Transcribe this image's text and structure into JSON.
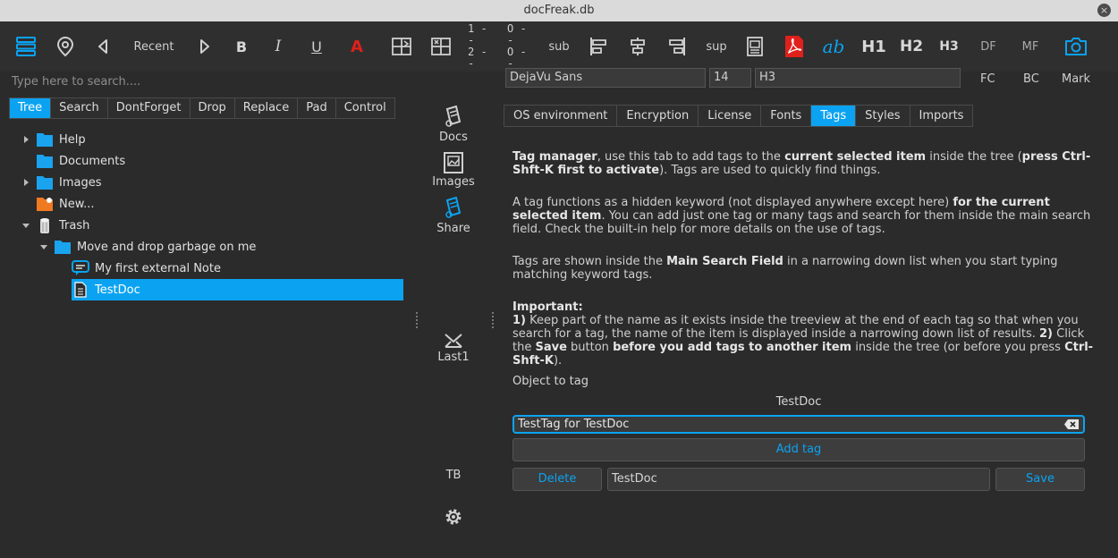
{
  "window": {
    "title": "docFreak.db",
    "close_glyph": "×"
  },
  "toolbar": {
    "recent": "Recent",
    "bold": "B",
    "italic": "I",
    "underline": "U",
    "color": "A",
    "list_num_1": "1 --",
    "list_num_2": "2 --",
    "list_bul_1": "O --",
    "list_bul_2": "O --",
    "sub": "sub",
    "sup": "sup",
    "spell": "ab",
    "h1": "H1",
    "h2": "H2",
    "h3": "H3",
    "df": "DF",
    "mf": "MF",
    "fc": "FC",
    "bc": "BC",
    "mark": "Mark"
  },
  "search": {
    "placeholder": "Type here to search...."
  },
  "format": {
    "font": "DejaVu Sans",
    "size": "14",
    "style": "H3"
  },
  "left_tabs": [
    "Tree",
    "Search",
    "DontForget",
    "Drop",
    "Replace",
    "Pad",
    "Control"
  ],
  "tree": {
    "help": "Help",
    "documents": "Documents",
    "images": "Images",
    "new": "New...",
    "trash": "Trash",
    "move": "Move  and drop garbage on me",
    "note": "My first external Note",
    "testdoc": "TestDoc"
  },
  "side": {
    "docs": "Docs",
    "images": "Images",
    "share": "Share",
    "last1": "Last1",
    "tb": "TB"
  },
  "right_tabs": [
    "OS environment",
    "Encryption",
    "License",
    "Fonts",
    "Tags",
    "Styles",
    "Imports"
  ],
  "tags": {
    "p1_a": "Tag manager",
    "p1_b": ", use this tab to add tags to the ",
    "p1_c": "current selected item",
    "p1_d": " inside the tree (",
    "p1_e": "press Ctrl-Shft-K first to activate",
    "p1_f": "). Tags are used to quickly find things.",
    "p2_a": "A tag functions as a hidden keyword (not displayed anywhere except here) ",
    "p2_b": "for the current selected item",
    "p2_c": ". You can add just one tag or many tags and search for them inside the main search field. Check the built-in help for more details on the use of tags.",
    "p3_a": "Tags are shown inside the ",
    "p3_b": "Main Search Field",
    "p3_c": " in a narrowing down list when you start typing matching keyword tags.",
    "imp": "Important:",
    "p4_a": "1)",
    "p4_b": " Keep part of the name as it exists inside the treeview at the end of each tag so that when you search for a tag, the name of the item is displayed inside a narrowing down list of results. ",
    "p4_c": "2)",
    "p4_d": " Click the ",
    "p4_e": "Save",
    "p4_f": " button ",
    "p4_g": "before you add tags to another item",
    "p4_h": " inside the tree (or before you press ",
    "p4_i": "Ctrl-Shft-K",
    "p4_j": ").",
    "object_label": "Object to tag",
    "object_name": "TestDoc",
    "tag_value": "TestTag for TestDoc",
    "add_tag": "Add tag",
    "delete": "Delete",
    "selected_tag": "TestDoc",
    "save": "Save"
  },
  "colors": {
    "accent": "#0ba3f1",
    "pdf_red": "#e0201b",
    "folder": "#1aa3ef",
    "new_orange": "#f07a22"
  }
}
